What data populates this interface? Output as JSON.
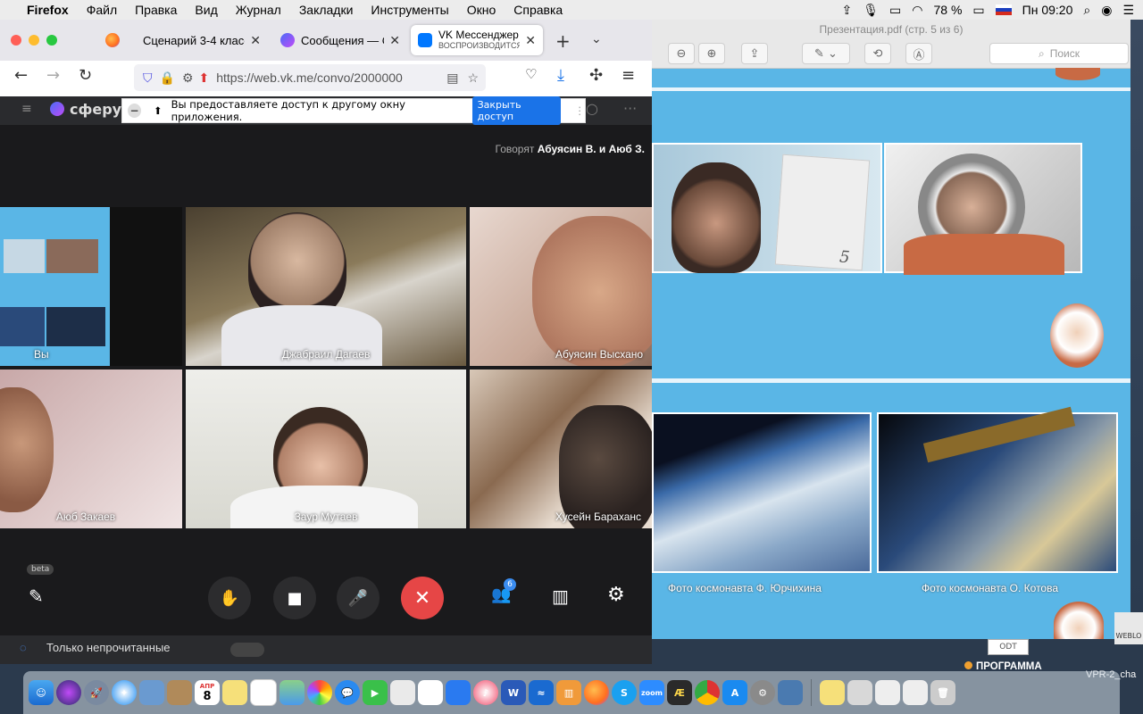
{
  "menubar": {
    "apple": "",
    "items": [
      "Firefox",
      "Файл",
      "Правка",
      "Вид",
      "Журнал",
      "Закладки",
      "Инструменты",
      "Окно",
      "Справка"
    ],
    "battery": "78 %",
    "clock": "Пн 09:20"
  },
  "browser": {
    "tabs": [
      {
        "title": "Сценарий 3-4 класс"
      },
      {
        "title": "Сообщения — Сф"
      },
      {
        "title": "VK Мессенджер",
        "subtitle": "ВОСПРОИЗВОДИТСЯ"
      }
    ],
    "url": "https://web.vk.me/convo/2000000",
    "sharing_notice": "Вы предоставляете доступ к другому окну приложения.",
    "stop_sharing_label": "Закрыть доступ",
    "logo_partial": "сферу"
  },
  "call": {
    "speaking_prefix": "Говорят",
    "speaking_names": "Абуясин В. и Аюб З.",
    "participants": [
      {
        "name": "Вы"
      },
      {
        "name": "Джабраил Дагаев"
      },
      {
        "name": "Абуясин Высхано"
      },
      {
        "name": "Аюб Закаев"
      },
      {
        "name": "Заур Мутаев"
      },
      {
        "name": "Хусейн Бараханс"
      }
    ],
    "beta_badge": "beta",
    "participants_count": "6",
    "unread_only_label": "Только непрочитанные"
  },
  "preview": {
    "title": "Презентация.pdf (стр. 5 из 6)",
    "search_placeholder": "Поиск",
    "page_number": "5",
    "captions": [
      "Фото космонавта Ф. Юрчихина",
      "Фото космонавта О. Котова"
    ]
  },
  "desktop": {
    "odt_label": "ODT",
    "program_label": "ПРОГРАММА",
    "weblo_label": "WEBLO",
    "right_edge_label": "VPR-2_cha"
  },
  "dock": {
    "calendar_month": "АПР",
    "calendar_day": "8",
    "zoom_label": "zoom"
  },
  "colors": {
    "accent_blue": "#1a73e8",
    "end_call_red": "#e64646",
    "slide_bg": "#5ab6e6"
  }
}
